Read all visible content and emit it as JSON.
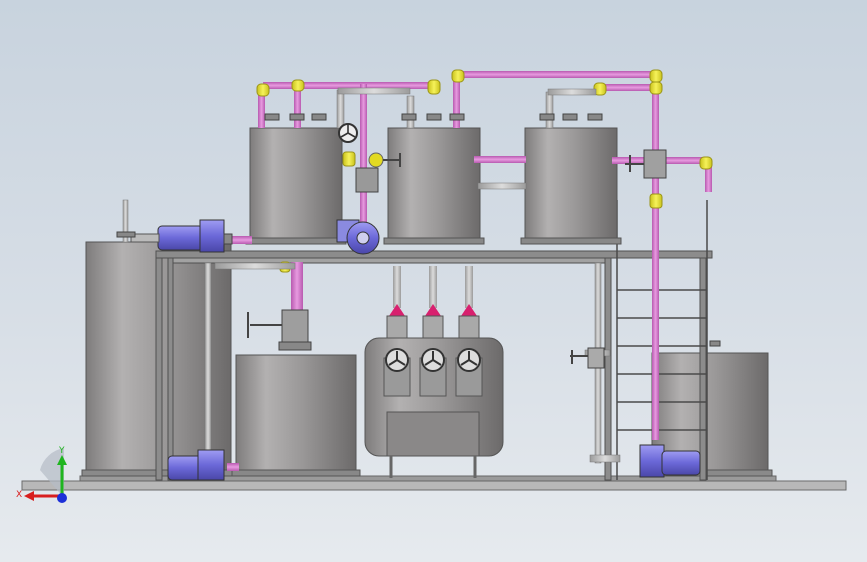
{
  "scene": {
    "description_visible": "",
    "triad": {
      "x_label": "X",
      "y_label": "Y"
    }
  },
  "colors": {
    "background_top": "#c8d3de",
    "background_bottom": "#e6eaee",
    "tank_gray": "#9a9898",
    "pipe_magenta": "#d97fd0",
    "elbow_yellow": "#e8e233",
    "pump_blue": "#7b78e0",
    "frame_gray": "#6f6f6f",
    "nozzle_red": "#d8206e",
    "axis_x": "#d81e1e",
    "axis_y": "#1fb51f",
    "axis_z": "#1c2fd8"
  }
}
